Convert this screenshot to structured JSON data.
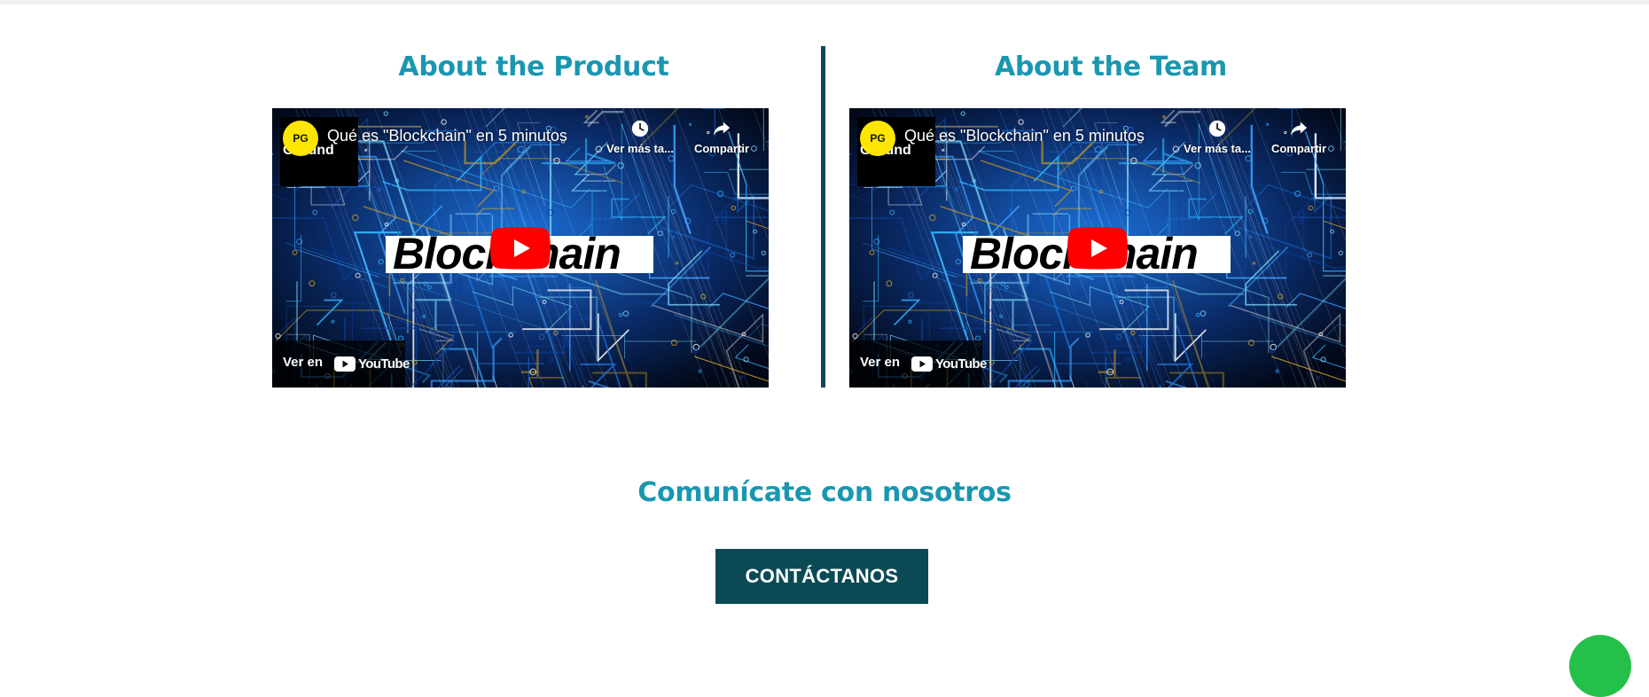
{
  "sections": {
    "product": {
      "title": "About the Product",
      "video": {
        "channel_avatar": "PG",
        "channel_name": "Ground",
        "title": "Qué es \"Blockchain\" en 5 minutos",
        "watch_later_label": "Ver más ta...",
        "share_label": "Compartir",
        "banner_text": "Blockchain",
        "watch_on_label": "Ver en",
        "platform_name": "YouTube"
      }
    },
    "team": {
      "title": "About the Team",
      "video": {
        "channel_avatar": "PG",
        "channel_name": "Ground",
        "title": "Qué es \"Blockchain\" en 5 minutos",
        "watch_later_label": "Ver más ta...",
        "share_label": "Compartir",
        "banner_text": "Blockchain",
        "watch_on_label": "Ver en",
        "platform_name": "YouTube"
      }
    }
  },
  "contact": {
    "title": "Comunícate con nosotros",
    "button_label": "CONTÁCTANOS"
  },
  "colors": {
    "heading": "#1a97b0",
    "accent_dark": "#0b4a55",
    "youtube_red": "#ff0000",
    "avatar_yellow": "#ffe600",
    "chat_green": "#25c04a"
  },
  "icons": {
    "watch_later": "clock-icon",
    "share": "share-arrow-icon",
    "play": "play-icon",
    "platform": "youtube-logo-icon",
    "chat": "chat-bubble-icon"
  }
}
